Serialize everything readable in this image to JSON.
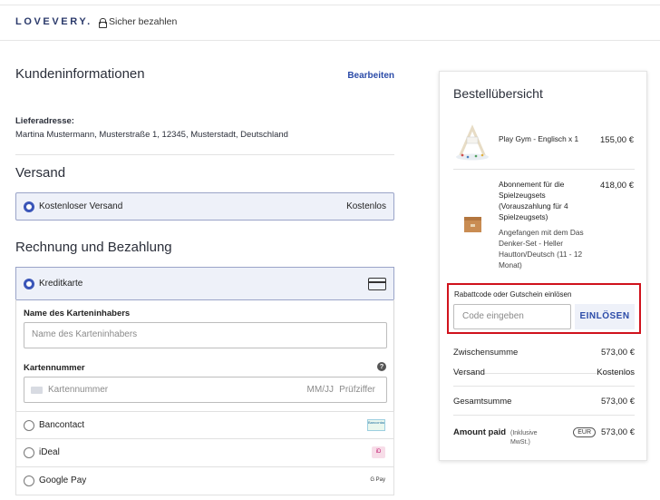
{
  "header": {
    "logo": "LOVEVERY.",
    "secure_label": "Sicher bezahlen"
  },
  "customer": {
    "title": "Kundeninformationen",
    "edit_label": "Bearbeiten",
    "address_label": "Lieferadresse:",
    "address": "Martina Mustermann, Musterstraße 1, 12345, Musterstadt, Deutschland"
  },
  "shipping": {
    "title": "Versand",
    "option_label": "Kostenloser Versand",
    "option_price": "Kostenlos"
  },
  "billing": {
    "title": "Rechnung und Bezahlung",
    "credit_card": {
      "label": "Kreditkarte",
      "name_label": "Name des Karteninhabers",
      "name_placeholder": "Name des Karteninhabers",
      "number_label": "Kartennummer",
      "number_placeholder": "Kartennummer",
      "expiry_placeholder": "MM/JJ",
      "cvc_placeholder": "Prüfziffer"
    },
    "methods": [
      {
        "label": "Bancontact",
        "logo_text": "Bancontact"
      },
      {
        "label": "iDeal",
        "logo_text": "iD"
      },
      {
        "label": "Google Pay",
        "logo_text": "G Pay"
      }
    ]
  },
  "summary": {
    "title": "Bestellübersicht",
    "items": [
      {
        "name": "Play Gym - Englisch x 1",
        "price": "155,00 €"
      },
      {
        "name": "Abonnement für die Spielzeugsets (Vorauszahlung für 4 Spielzeugsets)",
        "price": "418,00 €",
        "sub": "Angefangen mit dem Das Denker-Set - Heller Hautton/Deutsch (11 - 12 Monat)"
      }
    ],
    "promo": {
      "label": "Rabattcode oder Gutschein einlösen",
      "placeholder": "Code eingeben",
      "button": "EINLÖSEN"
    },
    "subtotal_label": "Zwischensumme",
    "subtotal": "573,00 €",
    "shipping_label": "Versand",
    "shipping": "Kostenlos",
    "total_label": "Gesamtsumme",
    "total": "573,00 €",
    "amount_paid_label": "Amount paid",
    "amount_paid_note": "(Inklusive MwSt.)",
    "currency": "EUR",
    "amount_paid": "573,00 €"
  },
  "colors": {
    "accent": "#3a55b8",
    "highlight_border": "#d0121c",
    "selected_bg": "#eef1f9"
  }
}
